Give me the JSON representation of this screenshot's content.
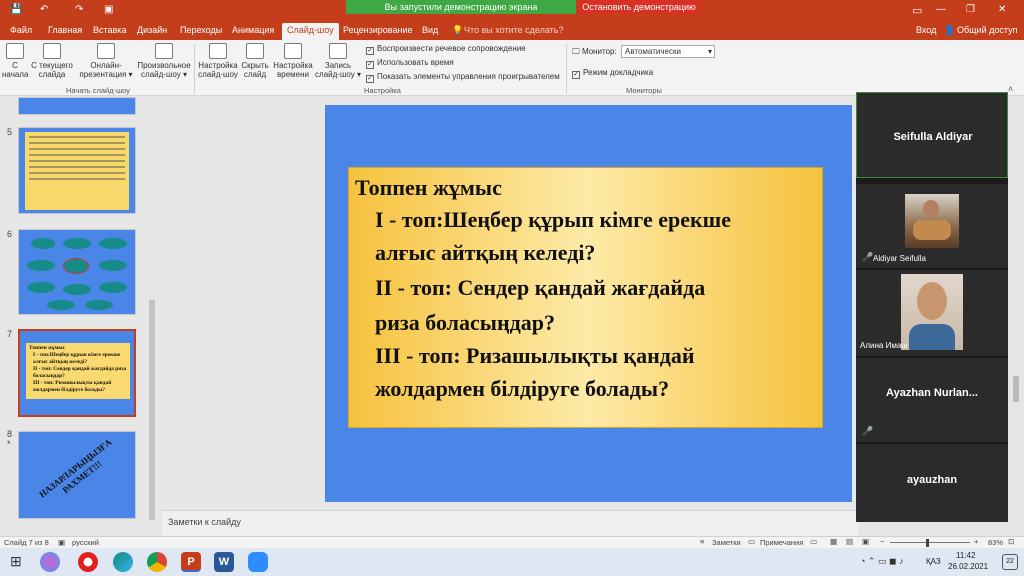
{
  "qat": {
    "save": "💾",
    "undo": "↶",
    "redo": "↷",
    "present": "▣"
  },
  "share": {
    "banner": "Вы запустили демонстрацию экрана",
    "stop": "Остановить демонстрацию"
  },
  "window": {
    "signin": "Вход",
    "share_label": "Общий доступ"
  },
  "tabs": [
    "Файл",
    "Главная",
    "Вставка",
    "Дизайн",
    "Переходы",
    "Анимация",
    "Слайд-шоу",
    "Рецензирование",
    "Вид"
  ],
  "active_tab": "Слайд-шоу",
  "search_placeholder": "Что вы хотите сделать?",
  "ribbon": {
    "start": [
      {
        "label": "С\nначала"
      },
      {
        "label": "С текущего\nслайда"
      },
      {
        "label": "Онлайн-\nпрезентация ▾"
      },
      {
        "label": "Произвольное\nслайд-шоу ▾"
      }
    ],
    "start_group": "Начать слайд-шоу",
    "setup": [
      {
        "label": "Настройка\nслайд-шоу"
      },
      {
        "label": "Скрыть\nслайд"
      },
      {
        "label": "Настройка\nвремени"
      },
      {
        "label": "Запись\nслайд-шоу ▾"
      }
    ],
    "setup_checks": [
      "Воспроизвести речевое сопровождение",
      "Использовать время",
      "Показать элементы управления проигрывателем"
    ],
    "setup_group": "Настройка",
    "monitor_label": "Монитор:",
    "monitor_value": "Автоматически",
    "presenter_view": "Режим докладчика",
    "monitors_group": "Мониторы"
  },
  "thumbnails": [
    {
      "num": "5"
    },
    {
      "num": "6"
    },
    {
      "num": "7",
      "title": "Топпен жұмыс",
      "lines": [
        "І - топ:Шеңбер құрып кімге ерекше алғыс айтқың келеді?",
        "ІІ - топ: Сендер қандай жағдайда риза боласыңдар?",
        "ІІІ - топ: Ризашылықты қандай жолдармен білдіруге болады?"
      ]
    },
    {
      "num": "8",
      "star": "*",
      "text": "НАЗАРЛАРЫҢЫЗҒА РАХМЕТ!!!"
    }
  ],
  "slide": {
    "title": "Топпен жұмыс",
    "lines": [
      "І - топ:Шеңбер құрып кімге ерекше",
      "алғыс айтқың келеді?",
      "ІІ - топ: Сендер қандай жағдайда",
      "риза боласыңдар?",
      "ІІІ - топ: Ризашылықты қандай",
      "жолдармен білдіруге болады?"
    ],
    "bg_color": "#4a86e8"
  },
  "notes_placeholder": "Заметки к слайду",
  "participants": [
    {
      "name": "Seifulla Aldiyar"
    },
    {
      "name": "Aldiyar Seifulla"
    },
    {
      "name": "Алина Имаш"
    },
    {
      "name": "Ayazhan  Nurlan..."
    },
    {
      "name": "ayauzhan"
    }
  ],
  "status": {
    "slide": "Слайд 7 из 8",
    "lang": "русский",
    "notes": "Заметки",
    "comments": "Примечания",
    "zoom": "83%"
  },
  "taskbar": {
    "lang": "ҚАЗ",
    "time": "11:42",
    "date": "26.02.2021",
    "notif": "22"
  }
}
